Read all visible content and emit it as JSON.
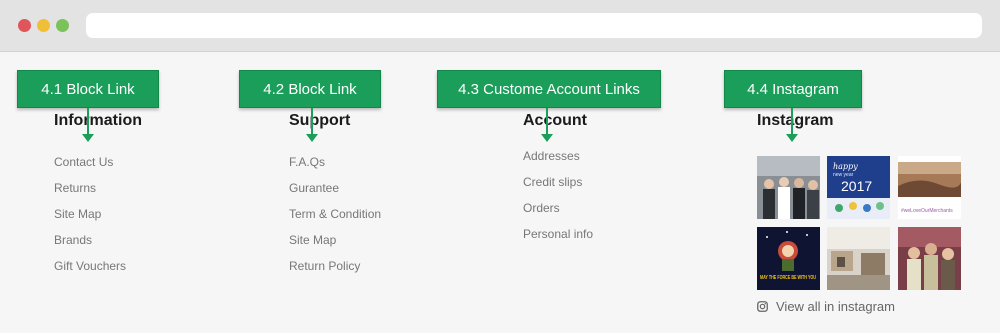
{
  "colors": {
    "accent": "#1a9e5a",
    "title": "#1b1b1b",
    "link": "#777777"
  },
  "callouts": [
    {
      "label": "4.1 Block Link"
    },
    {
      "label": "4.2 Block Link"
    },
    {
      "label": "4.3 Custome Account Links"
    },
    {
      "label": "4.4 Instagram"
    }
  ],
  "information": {
    "title": "Information",
    "links": [
      "Contact Us",
      "Returns",
      "Site Map",
      "Brands",
      "Gift Vouchers"
    ]
  },
  "support": {
    "title": "Support",
    "links": [
      "F.A.Qs",
      "Gurantee",
      "Term & Condition",
      "Site Map",
      "Return Policy"
    ]
  },
  "account": {
    "title": "Account",
    "links": [
      "Addresses",
      "Credit slips",
      "Orders",
      "Personal info"
    ]
  },
  "instagram": {
    "title": "Instagram",
    "thumb_texts": {
      "happy": "happy",
      "new_year": "new year",
      "year": "2017",
      "hashtag": "#weLoveOurMerchants",
      "force": "MAY THE FORCE BE WITH YOU"
    },
    "view_all": "View all in instagram",
    "icon": "instagram-icon"
  }
}
